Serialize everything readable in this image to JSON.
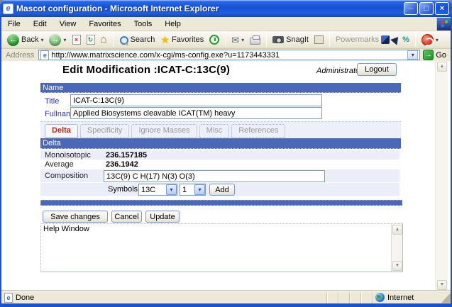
{
  "window": {
    "title": "Mascot configuration - Microsoft Internet Explorer",
    "menu": [
      "File",
      "Edit",
      "View",
      "Favorites",
      "Tools",
      "Help"
    ],
    "toolbar": {
      "back_label": "Back",
      "search_label": "Search",
      "favorites_label": "Favorites",
      "snagit_label": "SnagIt",
      "powermarks_label": "Powermarks"
    },
    "address": {
      "label": "Address",
      "url": "http://www.matrixscience.com/x-cgi/ms-config.exe?u=1173443331",
      "go_label": "Go"
    },
    "status": {
      "left": "Done",
      "zone": "Internet"
    }
  },
  "page": {
    "heading": "Edit Modification :ICAT-C:13C(9)",
    "user": "Administrator",
    "logout_label": "Logout",
    "name_section": {
      "header": "Name",
      "title_label": "Title",
      "title_value": "ICAT-C:13C(9)",
      "fullname_label": "Fullname",
      "fullname_value": "Applied Biosystems cleavable ICAT(TM) heavy"
    },
    "tabs": [
      {
        "label": "Delta",
        "active": true
      },
      {
        "label": "Specificity",
        "active": false
      },
      {
        "label": "Ignore Masses",
        "active": false
      },
      {
        "label": "Misc",
        "active": false
      },
      {
        "label": "References",
        "active": false
      }
    ],
    "delta_section": {
      "header": "Delta",
      "monoisotopic_label": "Monoisotopic",
      "monoisotopic_value": "236.157185",
      "average_label": "Average",
      "average_value": "236.1942",
      "composition_label": "Composition",
      "composition_value": "13C(9) C H(17) N(3) O(3)",
      "symbols_label": "Symbols",
      "symbol_selected": "13C",
      "count_selected": "1",
      "add_label": "Add"
    },
    "actions": {
      "save_label": "Save changes",
      "cancel_label": "Cancel",
      "update_label": "Update"
    },
    "help_window_text": "Help Window"
  },
  "colors": {
    "section_header_blue": "#4a68ba",
    "row_lavender": "#ebedf8",
    "active_tab_red": "#cc2211",
    "inactive_tab_gray": "#999999",
    "label_link_blue": "#3333cc",
    "chrome_tan": "#ece9d8",
    "titlebar_blue": "#1450cf"
  },
  "icons": {
    "dropdown": "▾",
    "back_arrow": "←",
    "forward_arrow": "→",
    "stop_x": "×",
    "refresh": "↻",
    "home": "⌂",
    "star": "★",
    "mail": "✉",
    "go_arrow": "→",
    "scroll_up": "▲",
    "scroll_down": "▼",
    "minimize": "_",
    "maximize": "□",
    "close": "×",
    "ie": "e",
    "percent": "%"
  }
}
